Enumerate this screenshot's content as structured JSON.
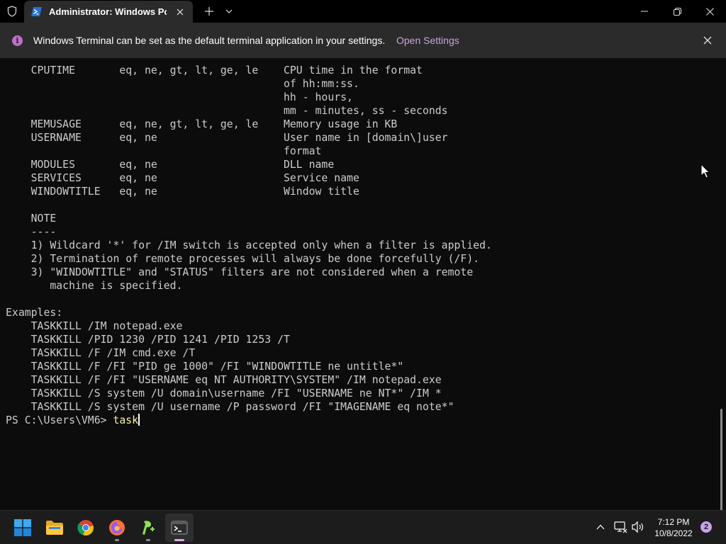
{
  "titlebar": {
    "tab_title": "Administrator: Windows PowerShell"
  },
  "infobar": {
    "message": "Windows Terminal can be set as the default terminal application in your settings.",
    "link": "Open Settings",
    "accent": "#c06fc9"
  },
  "terminal": {
    "lines": [
      "    CPUTIME       eq, ne, gt, lt, ge, le    CPU time in the format",
      "                                            of hh:mm:ss.",
      "                                            hh - hours,",
      "                                            mm - minutes, ss - seconds",
      "    MEMUSAGE      eq, ne, gt, lt, ge, le    Memory usage in KB",
      "    USERNAME      eq, ne                    User name in [domain\\]user",
      "                                            format",
      "    MODULES       eq, ne                    DLL name",
      "    SERVICES      eq, ne                    Service name",
      "    WINDOWTITLE   eq, ne                    Window title",
      "",
      "    NOTE",
      "    ----",
      "    1) Wildcard '*' for /IM switch is accepted only when a filter is applied.",
      "    2) Termination of remote processes will always be done forcefully (/F).",
      "    3) \"WINDOWTITLE\" and \"STATUS\" filters are not considered when a remote",
      "       machine is specified.",
      "",
      "Examples:",
      "    TASKKILL /IM notepad.exe",
      "    TASKKILL /PID 1230 /PID 1241 /PID 1253 /T",
      "    TASKKILL /F /IM cmd.exe /T",
      "    TASKKILL /F /FI \"PID ge 1000\" /FI \"WINDOWTITLE ne untitle*\"",
      "    TASKKILL /F /FI \"USERNAME eq NT AUTHORITY\\SYSTEM\" /IM notepad.exe",
      "    TASKKILL /S system /U domain\\username /FI \"USERNAME ne NT*\" /IM *",
      "    TASKKILL /S system /U username /P password /FI \"IMAGENAME eq note*\""
    ],
    "prompt": "PS C:\\Users\\VM6> ",
    "input": "task",
    "input_color": "#f9f1a5"
  },
  "taskbar": {
    "apps": [
      {
        "name": "start",
        "icon": "windows-logo-icon"
      },
      {
        "name": "file-explorer",
        "icon": "folder-icon"
      },
      {
        "name": "chrome",
        "icon": "chrome-icon"
      },
      {
        "name": "firefox",
        "icon": "firefox-icon"
      },
      {
        "name": "notepad-plus-plus",
        "icon": "notepad-plus-plus-icon"
      },
      {
        "name": "terminal",
        "icon": "terminal-icon"
      }
    ],
    "time": "7:12 PM",
    "date": "10/8/2022",
    "notification_count": "2"
  }
}
